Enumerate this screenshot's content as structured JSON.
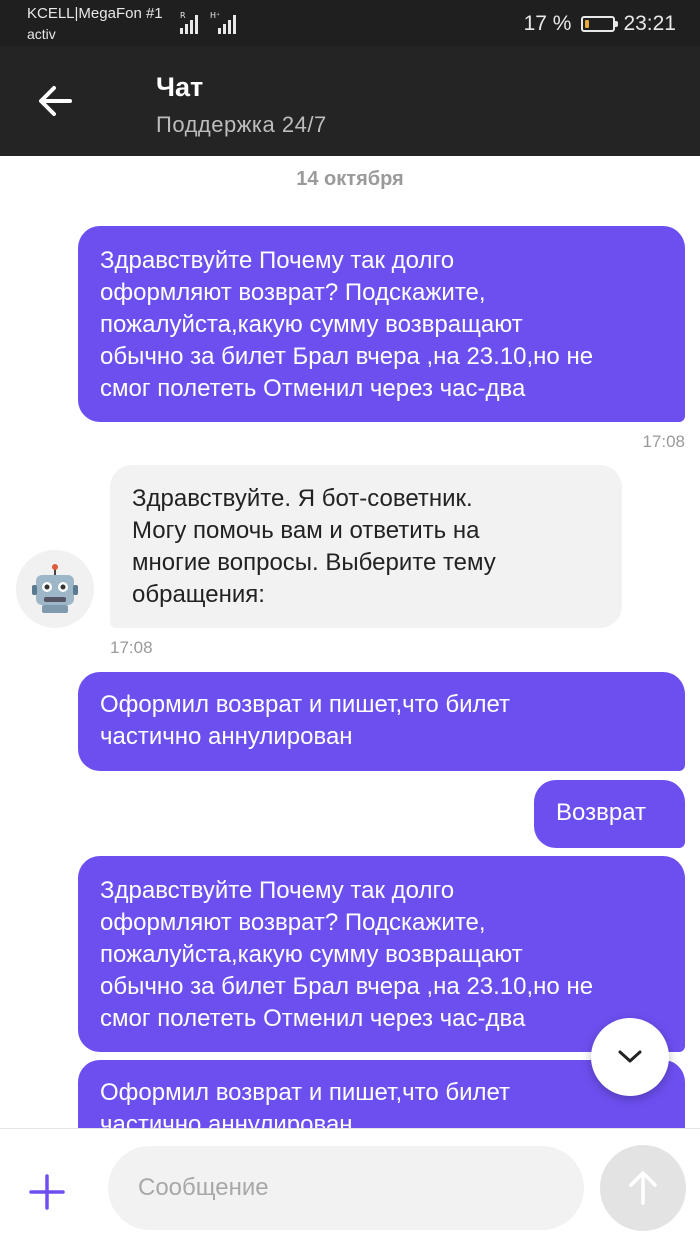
{
  "status_bar": {
    "carrier_line1": "KCELL|MegaFon #1",
    "carrier_line2": "activ",
    "battery_percent": "17 %",
    "battery_level": 0.17,
    "clock": "23:21"
  },
  "header": {
    "back_icon": "arrow-left-icon",
    "title": "Чат",
    "subtitle": "Поддержка 24/7"
  },
  "chat": {
    "date_separator": "14 октября",
    "messages": [
      {
        "direction": "outgoing",
        "lines": [
          "Здравствуйте Почему так долго",
          "оформляют возврат? Подскажите,",
          "пожалуйста,какую сумму возвращают",
          "обычно за билет Брал вчера ,на 23.10,но не",
          "смог полететь Отменил через час-два"
        ],
        "time": "17:08"
      },
      {
        "direction": "incoming",
        "lines": [
          "Здравствуйте. Я бот-советник.",
          "Могу помочь вам и ответить на",
          "многие вопросы. Выберите тему",
          "обращения:"
        ],
        "time": "17:08",
        "avatar_icon": "robot-icon"
      },
      {
        "direction": "outgoing",
        "lines": [
          "Оформил возврат и пишет,что билет",
          "частично аннулирован"
        ]
      },
      {
        "direction": "outgoing",
        "lines": [
          "Возврат"
        ]
      },
      {
        "direction": "outgoing",
        "lines": [
          "Здравствуйте Почему так долго",
          "оформляют возврат? Подскажите,",
          "пожалуйста,какую сумму возвращают",
          "обычно за билет Брал вчера ,на 23.10,но не",
          "смог полететь Отменил через час-два"
        ]
      },
      {
        "direction": "outgoing",
        "lines": [
          "Оформил возврат и пишет,что билет",
          "частично аннулирован"
        ]
      }
    ],
    "scroll_down_icon": "chevron-down-icon"
  },
  "input_bar": {
    "add_icon": "plus-icon",
    "placeholder": "Сообщение",
    "send_icon": "arrow-up-icon"
  },
  "colors": {
    "accent": "#6d4ff0",
    "header_bg": "#242424",
    "status_bg": "#1f1f1f",
    "incoming_bubble": "#f2f2f2"
  }
}
